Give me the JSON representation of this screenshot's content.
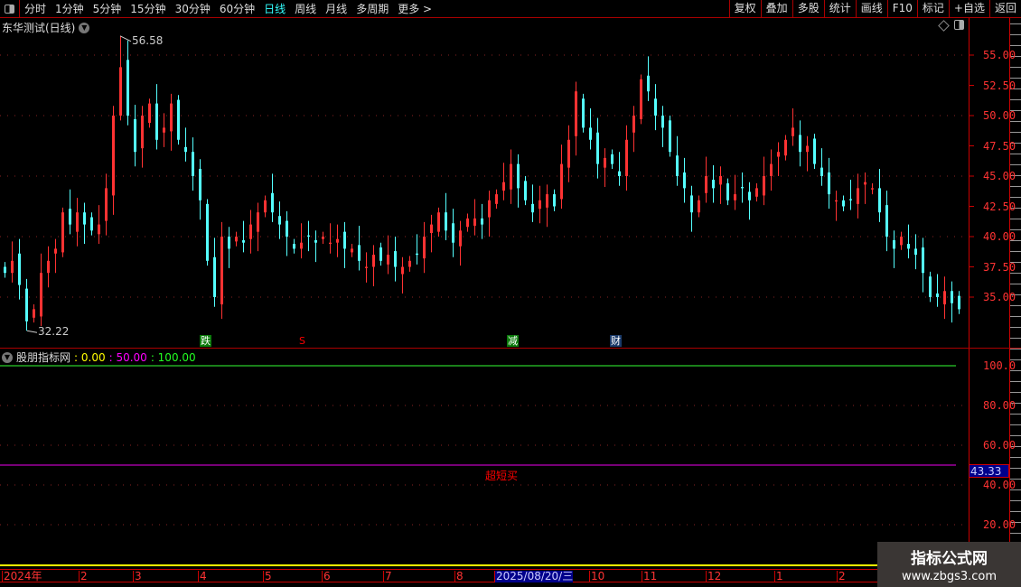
{
  "toolbar": {
    "periods": [
      "分时",
      "1分钟",
      "5分钟",
      "15分钟",
      "30分钟",
      "60分钟",
      "日线",
      "周线",
      "月线",
      "多周期",
      "更多 >"
    ],
    "active": "日线",
    "right_buttons": [
      "复权",
      "叠加",
      "多股",
      "统计",
      "画线",
      "F10",
      "标记",
      "+自选",
      "返回"
    ]
  },
  "title": "东华测试(日线)",
  "indicator": {
    "name": "股朋指标网",
    "v1": ": 0.00",
    "v2": ": 50.00",
    "v3": ": 100.00",
    "current": "43.33",
    "signal_label": "超短买"
  },
  "signals": [
    {
      "text": "跌",
      "bg": "#0a7a0a",
      "color": "#fff"
    },
    {
      "text": "S",
      "bg": "transparent",
      "color": "#f00"
    },
    {
      "text": "减",
      "bg": "#0a7a0a",
      "color": "#fff"
    },
    {
      "text": "财",
      "bg": "#1a3a6a",
      "color": "#fff"
    }
  ],
  "date_axis": [
    "2024年",
    "2",
    "3",
    "4",
    "5",
    "6",
    "7",
    "8",
    "2025/08/20/三",
    "10",
    "11",
    "12",
    "1",
    "2"
  ],
  "watermark": {
    "line1": "指标公式网",
    "line2": "www.zbgs3.com"
  },
  "chart_data": {
    "type": "candlestick",
    "price_axis": [
      "55.00",
      "52.50",
      "50.00",
      "47.50",
      "45.00",
      "42.50",
      "40.00",
      "37.50",
      "35.00"
    ],
    "price_range": [
      32,
      57.5
    ],
    "indicator_axis": [
      "100.0",
      "80.00",
      "60.00",
      "40.00",
      "20.00"
    ],
    "indicator_range": [
      0,
      100
    ],
    "annotations": {
      "high": "56.58",
      "low": "32.22"
    },
    "colors": {
      "up": "#ff3232",
      "down": "#54ffff"
    },
    "closes": [
      37,
      38,
      36,
      33,
      34,
      37,
      38,
      39,
      42,
      41,
      42,
      41,
      40.5,
      41,
      44,
      50,
      54,
      50,
      47,
      50,
      51,
      48,
      49,
      51,
      48,
      47,
      45,
      43,
      38,
      35,
      40,
      39,
      40,
      39.5,
      41,
      42,
      43,
      42,
      41,
      40,
      39,
      39.5,
      40,
      39.5,
      40,
      39.5,
      39.8,
      39,
      39,
      38,
      37.5,
      38.5,
      38,
      38.5,
      37.5,
      37.5,
      38,
      38.5,
      40,
      41,
      42,
      40.5,
      39.5,
      40.5,
      41.5,
      41.5,
      41,
      43,
      43.5,
      44.5,
      46,
      44,
      43,
      42,
      43,
      43.5,
      42.5,
      46,
      48,
      52,
      49,
      48,
      46,
      46.5,
      46,
      45,
      48,
      50,
      53,
      52,
      50,
      49,
      47,
      45,
      44,
      42,
      43,
      45,
      44,
      45,
      43,
      43.5,
      44,
      43,
      44,
      45,
      46,
      47,
      48,
      49,
      47,
      47.5,
      46,
      45,
      43.5,
      43,
      42.5,
      43,
      44,
      44.5,
      44,
      42,
      40,
      39,
      40,
      39,
      38.5,
      37,
      35,
      35,
      35.5,
      34.5,
      34
    ]
  }
}
